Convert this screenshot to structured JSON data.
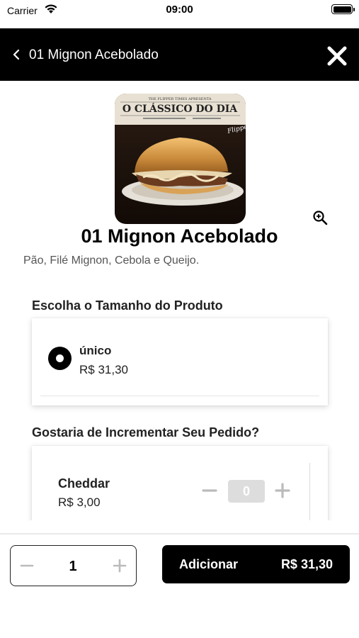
{
  "status_bar": {
    "carrier": "Carrier",
    "time": "09:00"
  },
  "header": {
    "title": "01 Mignon Acebolado",
    "back_icon": "chevron-left-icon",
    "close_icon": "close-icon"
  },
  "product": {
    "name": "01 Mignon Acebolado",
    "description": "Pão, Filé Mignon, Cebola e Queijo.",
    "image_banner": "O CLÁSSICO DO DIA",
    "image_top_line": "THE FLIPPER TIMES APRESENTA",
    "zoom_icon": "zoom-in-icon"
  },
  "size_section": {
    "title": "Escolha o Tamanho do Produto",
    "options": [
      {
        "name": "único",
        "price": "R$ 31,30",
        "selected": true
      }
    ]
  },
  "extras_section": {
    "title": "Gostaria de Incrementar Seu Pedido?",
    "items": [
      {
        "name": "Cheddar",
        "price": "R$ 3,00",
        "quantity": "0"
      }
    ]
  },
  "footer": {
    "quantity": "1",
    "add_label": "Adicionar",
    "total": "R$ 31,30"
  },
  "colors": {
    "header_bg": "#000000",
    "primary_button": "#000000",
    "stepper_disabled": "#bbbbbb"
  }
}
